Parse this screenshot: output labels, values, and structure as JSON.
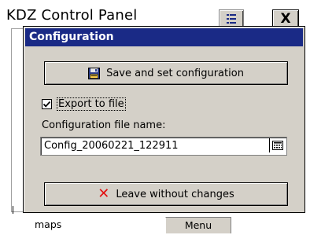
{
  "background_window": {
    "title": "KDZ Control Panel",
    "close_label": "X",
    "bottom_left_label": "maps",
    "menu_label": "Menu"
  },
  "dialog": {
    "title": "Configuration",
    "save_button_label": "Save and set configuration",
    "export_checkbox": {
      "label": "Export to file",
      "checked": true
    },
    "filename_label": "Configuration file name:",
    "filename_value": "Config_20060221_122911",
    "leave_button_label": "Leave without changes"
  },
  "icons": {
    "save": "floppy-disk-icon",
    "leave": "red-x-icon",
    "keyboard": "keyboard-icon",
    "background_button": "list-icon"
  },
  "colors": {
    "dialog_title_bar": "#1a2a86",
    "dialog_face": "#d4d0c8",
    "leave_x": "#e31010"
  }
}
